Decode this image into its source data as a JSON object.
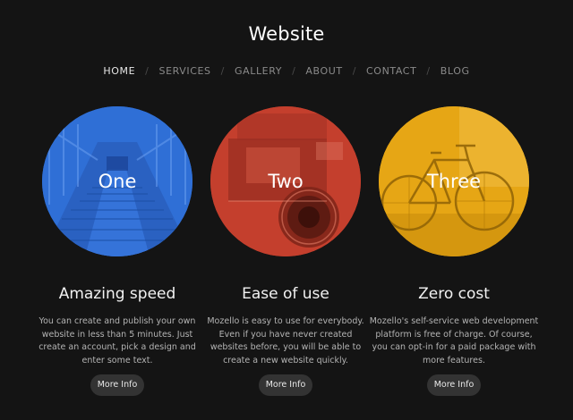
{
  "site": {
    "title": "Website"
  },
  "nav": {
    "items": [
      {
        "label": "HOME",
        "active": true
      },
      {
        "label": "SERVICES",
        "active": false
      },
      {
        "label": "GALLERY",
        "active": false
      },
      {
        "label": "ABOUT",
        "active": false
      },
      {
        "label": "CONTACT",
        "active": false
      },
      {
        "label": "BLOG",
        "active": false
      }
    ],
    "separator": "/"
  },
  "features": [
    {
      "circle_label": "One",
      "circle_color": "#2e6fd8",
      "image": "bridge-photo",
      "title": "Amazing speed",
      "text": "You can create and publish your own website in less than 5 minutes. Just create an account, pick a design and enter some text.",
      "button": "More Info"
    },
    {
      "circle_label": "Two",
      "circle_color": "#c9402e",
      "image": "vintage-camera-photo",
      "title": "Ease of use",
      "text": "Mozello is easy to use for everybody. Even if you have never created websites before, you will be able to create a new website quickly.",
      "button": "More Info"
    },
    {
      "circle_label": "Three",
      "circle_color": "#e8a812",
      "image": "bicycle-photo",
      "title": "Zero cost",
      "text": "Mozello's self-service web development platform is free of charge. Of course, you can opt-in for a paid package with more features.",
      "button": "More Info"
    }
  ]
}
